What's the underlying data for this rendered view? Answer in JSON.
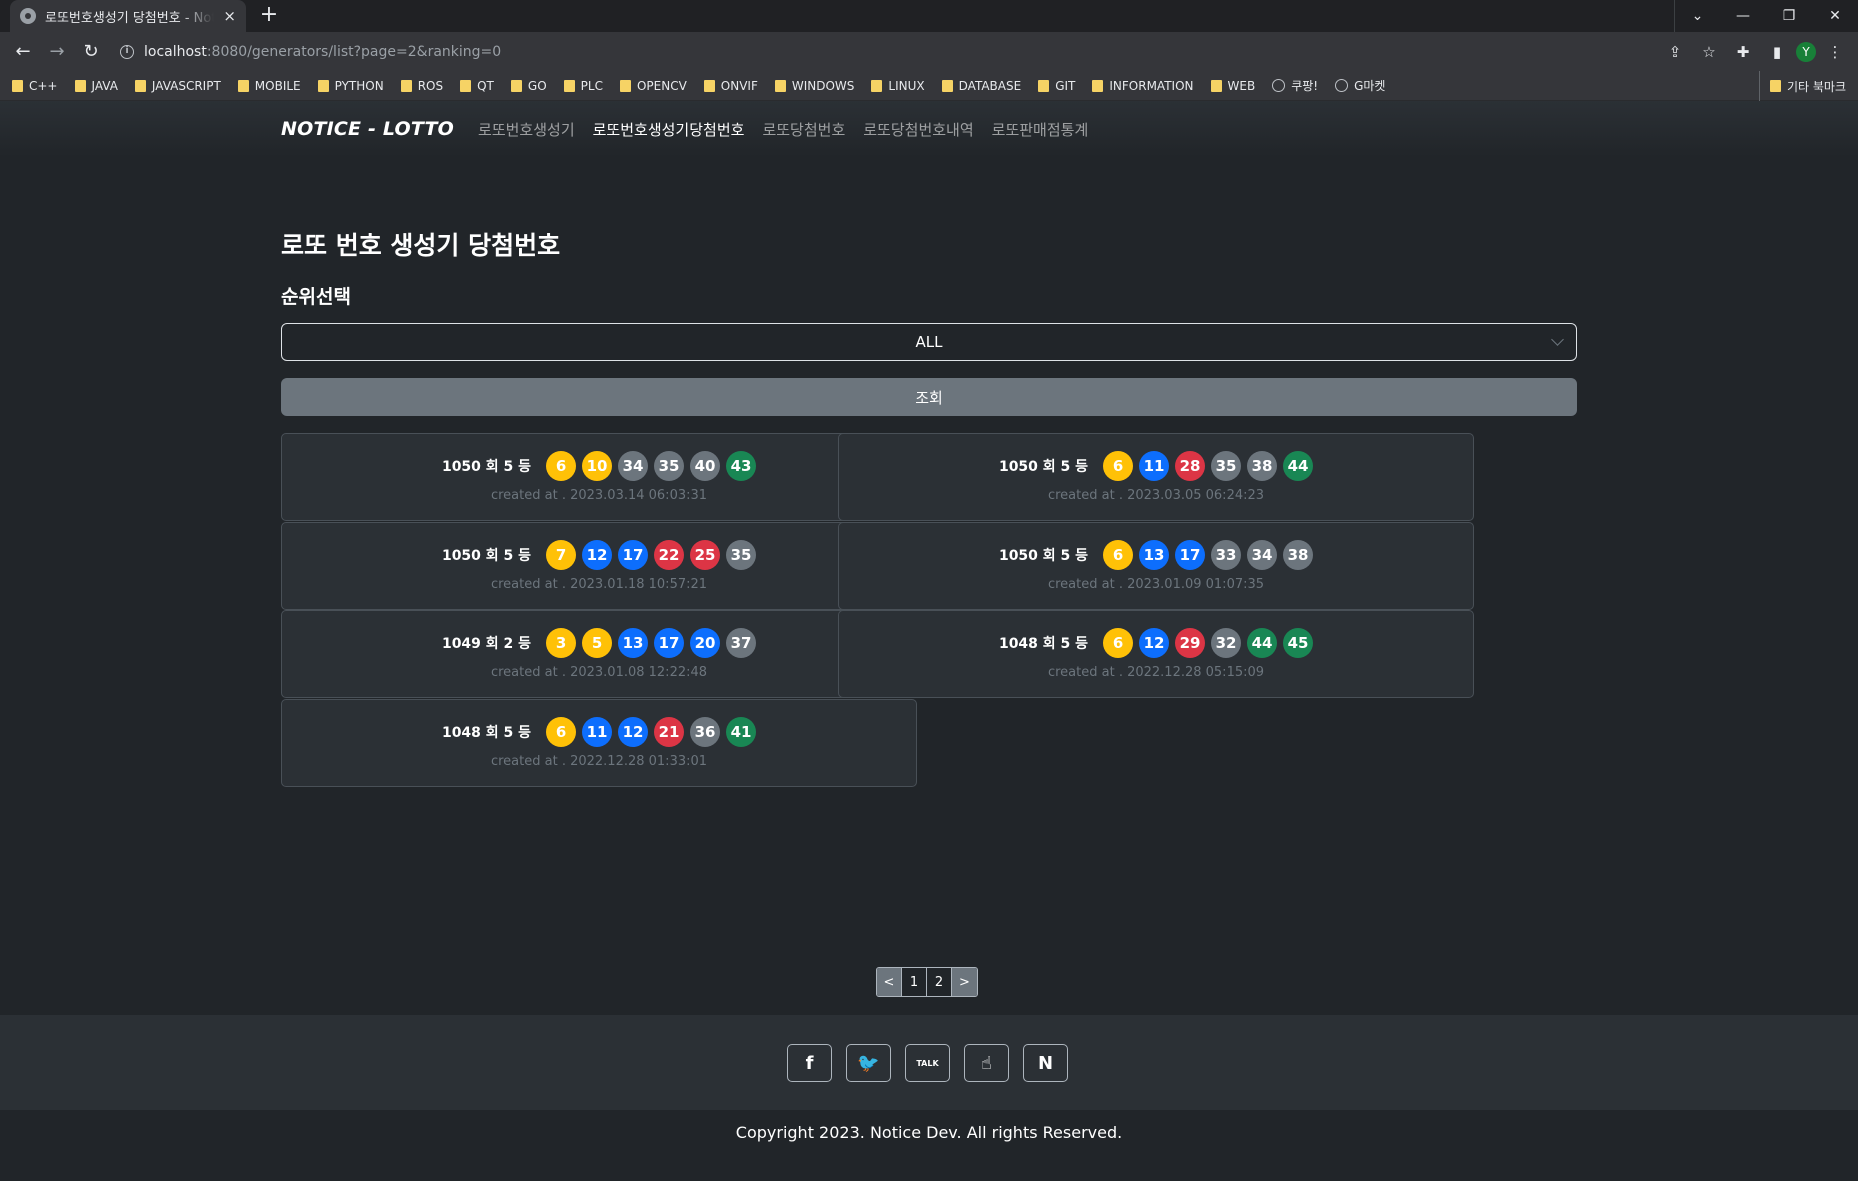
{
  "browser": {
    "tab_title": "로또번호생성기 당첨번호 - Notice",
    "tab_close": "×",
    "new_tab": "+",
    "url_host": "localhost",
    "url_rest": ":8080/generators/list?page=2&ranking=0",
    "bookmarks": [
      {
        "label": "C++",
        "icon": "folder-icon"
      },
      {
        "label": "JAVA",
        "icon": "folder-icon"
      },
      {
        "label": "JAVASCRIPT",
        "icon": "folder-icon"
      },
      {
        "label": "MOBILE",
        "icon": "folder-icon"
      },
      {
        "label": "PYTHON",
        "icon": "folder-icon"
      },
      {
        "label": "ROS",
        "icon": "folder-icon"
      },
      {
        "label": "QT",
        "icon": "folder-icon"
      },
      {
        "label": "GO",
        "icon": "folder-icon"
      },
      {
        "label": "PLC",
        "icon": "folder-icon"
      },
      {
        "label": "OPENCV",
        "icon": "folder-icon"
      },
      {
        "label": "ONVIF",
        "icon": "folder-icon"
      },
      {
        "label": "WINDOWS",
        "icon": "folder-icon"
      },
      {
        "label": "LINUX",
        "icon": "folder-icon"
      },
      {
        "label": "DATABASE",
        "icon": "folder-icon"
      },
      {
        "label": "GIT",
        "icon": "folder-icon"
      },
      {
        "label": "INFORMATION",
        "icon": "folder-icon"
      },
      {
        "label": "WEB",
        "icon": "folder-icon"
      },
      {
        "label": "쿠팡!",
        "icon": "globe-icon"
      },
      {
        "label": "G마켓",
        "icon": "globe-icon"
      }
    ],
    "other_bookmarks": "기타 북마크",
    "profile_initial": "Y"
  },
  "nav": {
    "brand": "NOTICE - LOTTO",
    "links": [
      {
        "label": "로또번호생성기",
        "active": false
      },
      {
        "label": "로또번호생성기당첨번호",
        "active": true
      },
      {
        "label": "로또당첨번호",
        "active": false
      },
      {
        "label": "로또당첨번호내역",
        "active": false
      },
      {
        "label": "로또판매점통계",
        "active": false
      }
    ]
  },
  "main": {
    "title": "로또 번호 생성기 당첨번호",
    "select_label": "순위선택",
    "select_value": "ALL",
    "search_button": "조회"
  },
  "cards": [
    {
      "draw": "1050 회 5 등",
      "balls": [
        {
          "n": "6",
          "c": "y"
        },
        {
          "n": "10",
          "c": "y"
        },
        {
          "n": "34",
          "c": "g"
        },
        {
          "n": "35",
          "c": "g"
        },
        {
          "n": "40",
          "c": "g"
        },
        {
          "n": "43",
          "c": "gr"
        }
      ],
      "created": "created at . 2023.03.14 06:03:31"
    },
    {
      "draw": "1050 회 5 등",
      "balls": [
        {
          "n": "6",
          "c": "y"
        },
        {
          "n": "11",
          "c": "b"
        },
        {
          "n": "28",
          "c": "r"
        },
        {
          "n": "35",
          "c": "g"
        },
        {
          "n": "38",
          "c": "g"
        },
        {
          "n": "44",
          "c": "gr"
        }
      ],
      "created": "created at . 2023.03.05 06:24:23"
    },
    {
      "draw": "1050 회 5 등",
      "balls": [
        {
          "n": "7",
          "c": "y"
        },
        {
          "n": "12",
          "c": "b"
        },
        {
          "n": "17",
          "c": "b"
        },
        {
          "n": "22",
          "c": "r"
        },
        {
          "n": "25",
          "c": "r"
        },
        {
          "n": "35",
          "c": "g"
        }
      ],
      "created": "created at . 2023.01.18 10:57:21"
    },
    {
      "draw": "1050 회 5 등",
      "balls": [
        {
          "n": "6",
          "c": "y"
        },
        {
          "n": "13",
          "c": "b"
        },
        {
          "n": "17",
          "c": "b"
        },
        {
          "n": "33",
          "c": "g"
        },
        {
          "n": "34",
          "c": "g"
        },
        {
          "n": "38",
          "c": "g"
        }
      ],
      "created": "created at . 2023.01.09 01:07:35"
    },
    {
      "draw": "1049 회 2 등",
      "balls": [
        {
          "n": "3",
          "c": "y"
        },
        {
          "n": "5",
          "c": "y"
        },
        {
          "n": "13",
          "c": "b"
        },
        {
          "n": "17",
          "c": "b"
        },
        {
          "n": "20",
          "c": "b"
        },
        {
          "n": "37",
          "c": "g"
        }
      ],
      "created": "created at . 2023.01.08 12:22:48"
    },
    {
      "draw": "1048 회 5 등",
      "balls": [
        {
          "n": "6",
          "c": "y"
        },
        {
          "n": "12",
          "c": "b"
        },
        {
          "n": "29",
          "c": "r"
        },
        {
          "n": "32",
          "c": "g"
        },
        {
          "n": "44",
          "c": "gr"
        },
        {
          "n": "45",
          "c": "gr"
        }
      ],
      "created": "created at . 2022.12.28 05:15:09"
    },
    {
      "draw": "1048 회 5 등",
      "balls": [
        {
          "n": "6",
          "c": "y"
        },
        {
          "n": "11",
          "c": "b"
        },
        {
          "n": "12",
          "c": "b"
        },
        {
          "n": "21",
          "c": "r"
        },
        {
          "n": "36",
          "c": "g"
        },
        {
          "n": "41",
          "c": "gr"
        }
      ],
      "created": "created at . 2022.12.28 01:33:01"
    }
  ],
  "pagination": {
    "prev": "<",
    "pages": [
      "1",
      "2"
    ],
    "current": "2",
    "next": ">"
  },
  "footer": {
    "social": [
      {
        "icon": "facebook-icon",
        "glyph": "f"
      },
      {
        "icon": "twitter-icon",
        "glyph": "🐦"
      },
      {
        "icon": "kakaotalk-icon",
        "glyph": "TALK"
      },
      {
        "icon": "hand-icon",
        "glyph": "☝"
      },
      {
        "icon": "naver-icon",
        "glyph": "N"
      }
    ],
    "copyright": "Copyright 2023. Notice Dev. All rights Reserved."
  },
  "colors": {
    "yellow": "#ffc107",
    "blue": "#0d6efd",
    "red": "#dc3545",
    "gray": "#6c757d",
    "green": "#198754"
  }
}
